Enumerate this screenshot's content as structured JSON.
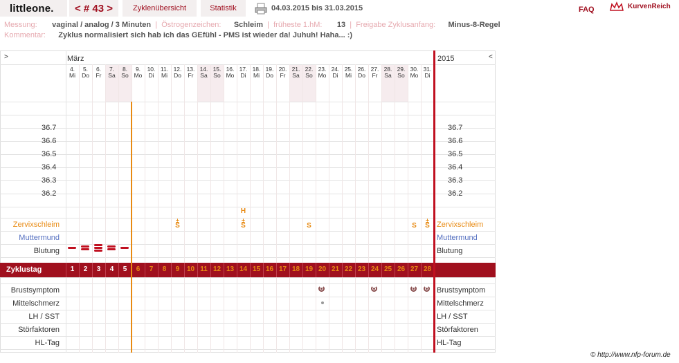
{
  "nav": {
    "brand": "littleone.",
    "cycle": "< # 43 >",
    "tab_overview": "Zyklenübersicht",
    "tab_stats": "Statistik",
    "date_range": "04.03.2015 bis 31.03.2015",
    "faq": "FAQ",
    "site": "KurvenReich"
  },
  "info": {
    "messung_label": "Messung:",
    "messung_value": "vaginal / analog / 3 Minuten",
    "oestrogen_label": "Östrogenzeichen:",
    "oestrogen_value": "Schleim",
    "hm_label": "früheste 1.hM:",
    "hm_value": "13",
    "freigabe_label": "Freigabe Zyklusanfang:",
    "freigabe_value": "Minus-8-Regel",
    "kommentar_label": "Kommentar:",
    "kommentar_value": "Zyklus normalisiert sich hab ich das GEfühl - PMS ist wieder da! Juhuh! Haha... :)"
  },
  "chart": {
    "left_arrow": ">",
    "right_arrow": "<",
    "month": "März",
    "year": "2015",
    "days": [
      {
        "d": "4.",
        "w": "Mi"
      },
      {
        "d": "5.",
        "w": "Do"
      },
      {
        "d": "6.",
        "w": "Fr"
      },
      {
        "d": "7.",
        "w": "Sa"
      },
      {
        "d": "8.",
        "w": "So"
      },
      {
        "d": "9.",
        "w": "Mo"
      },
      {
        "d": "10.",
        "w": "Di"
      },
      {
        "d": "11.",
        "w": "Mi"
      },
      {
        "d": "12.",
        "w": "Do"
      },
      {
        "d": "13.",
        "w": "Fr"
      },
      {
        "d": "14.",
        "w": "Sa"
      },
      {
        "d": "15.",
        "w": "So"
      },
      {
        "d": "16.",
        "w": "Mo"
      },
      {
        "d": "17.",
        "w": "Di"
      },
      {
        "d": "18.",
        "w": "Mi"
      },
      {
        "d": "19.",
        "w": "Do"
      },
      {
        "d": "20.",
        "w": "Fr"
      },
      {
        "d": "21.",
        "w": "Sa"
      },
      {
        "d": "22.",
        "w": "So"
      },
      {
        "d": "23.",
        "w": "Mo"
      },
      {
        "d": "24.",
        "w": "Di"
      },
      {
        "d": "25.",
        "w": "Mi"
      },
      {
        "d": "26.",
        "w": "Do"
      },
      {
        "d": "27.",
        "w": "Fr"
      },
      {
        "d": "28.",
        "w": "Sa"
      },
      {
        "d": "29.",
        "w": "So"
      },
      {
        "d": "30.",
        "w": "Mo"
      },
      {
        "d": "31.",
        "w": "Di"
      }
    ],
    "temps": [
      "36.7",
      "36.6",
      "36.5",
      "36.4",
      "36.3",
      "36.2"
    ],
    "rows": {
      "zervix": "Zervixschleim",
      "muttermund": "Muttermund",
      "blutung": "Blutung",
      "zyklustag": "Zyklustag",
      "brust": "Brustsymptom",
      "mittel": "Mittelschmerz",
      "lh": "LH / SST",
      "stoer": "Störfaktoren",
      "hl": "HL-Tag"
    },
    "cycle_days": [
      "1",
      "2",
      "3",
      "4",
      "5",
      "6",
      "7",
      "8",
      "9",
      "10",
      "11",
      "12",
      "13",
      "14",
      "15",
      "16",
      "17",
      "18",
      "19",
      "20",
      "21",
      "22",
      "23",
      "24",
      "25",
      "26",
      "27",
      "28"
    ],
    "zervix_marks": [
      {
        "day": 9,
        "mark": "S",
        "plus": "±"
      },
      {
        "day": 14,
        "mark": "S",
        "plus": "±"
      },
      {
        "day": 19,
        "mark": "S",
        "plus": ""
      },
      {
        "day": 27,
        "mark": "S",
        "plus": ""
      },
      {
        "day": 28,
        "mark": "S",
        "plus": "±"
      }
    ],
    "h_mark": {
      "day": 14,
      "text": "H"
    },
    "brust_days": [
      20,
      24,
      27,
      28
    ],
    "mittel_days": [
      20
    ]
  },
  "footer": {
    "copyright": "© http://www.nfp-forum.de",
    "cut_text": "Störfaktoren"
  },
  "colors": {
    "accent": "#a0101e",
    "orange": "#e88a12",
    "blue": "#5570c0"
  }
}
